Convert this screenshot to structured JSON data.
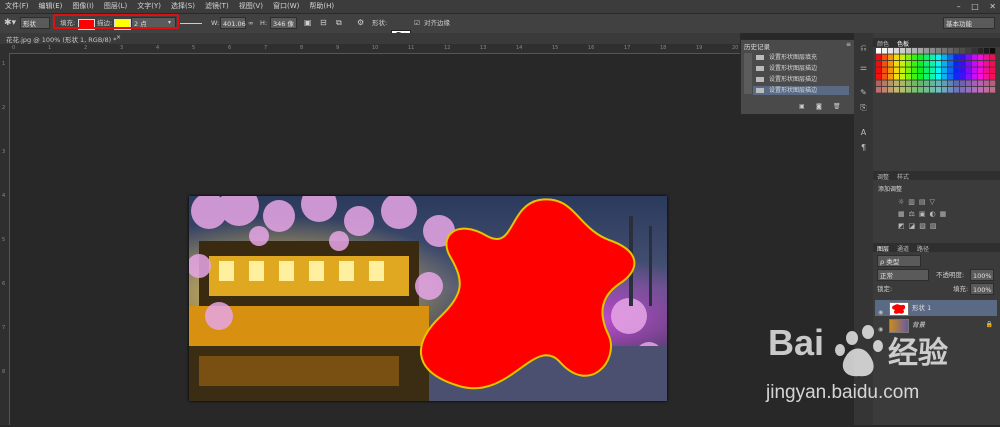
{
  "menubar": {
    "items": [
      "文件(F)",
      "编辑(E)",
      "图像(I)",
      "图层(L)",
      "文字(Y)",
      "选择(S)",
      "滤镜(T)",
      "视图(V)",
      "窗口(W)",
      "帮助(H)"
    ],
    "window_controls": [
      "–",
      "□",
      "✕"
    ]
  },
  "options": {
    "tool_mode": "形状",
    "fill_label": "填充:",
    "fill_color": "#ff0000",
    "stroke_label": "描边:",
    "stroke_color": "#ffff00",
    "stroke_width": "2 点",
    "w_label": "W:",
    "w_value": "401.06",
    "h_label": "H:",
    "h_value": "346 像",
    "shape_label": "形状:",
    "align_edges": "对齐边缘",
    "workspace": "基本功能"
  },
  "document": {
    "tab_label": "花花.jpg @ 100% (形状 1, RGB/8) *",
    "ruler_top_ticks": [
      "0",
      "1",
      "2",
      "3",
      "4",
      "5",
      "6",
      "7",
      "8",
      "9",
      "10",
      "11",
      "12",
      "13",
      "14",
      "15",
      "16",
      "17",
      "18",
      "19",
      "20"
    ],
    "ruler_left_ticks": [
      "1",
      "2",
      "3",
      "4",
      "5",
      "6",
      "7",
      "8"
    ]
  },
  "history": {
    "title": "历史记录",
    "items": [
      "设置形状图层填充",
      "设置形状图层描边",
      "设置形状图层描边",
      "设置形状图层描边"
    ]
  },
  "right_panels": {
    "color_tabs": [
      "颜色",
      "色板"
    ],
    "adjust_tabs": [
      "调整",
      "样式"
    ],
    "adjust_title": "添加调整",
    "layers_tabs": [
      "图层",
      "通道",
      "路径"
    ],
    "filter_kind": "ρ 类型",
    "blend_mode": "正常",
    "opacity_label": "不透明度:",
    "opacity_value": "100%",
    "lock_label": "锁定:",
    "fill_label": "填充:",
    "fill_value": "100%",
    "layers": [
      {
        "name": "形状 1",
        "selected": true
      },
      {
        "name": "背景",
        "selected": false
      }
    ]
  },
  "watermark": {
    "brand": "Bai",
    "brand2": "经验",
    "url": "jingyan.baidu.com"
  },
  "colors": {
    "shape_fill": "#ff0000",
    "shape_stroke": "#e6c400",
    "selection_outline": "#d11111"
  }
}
